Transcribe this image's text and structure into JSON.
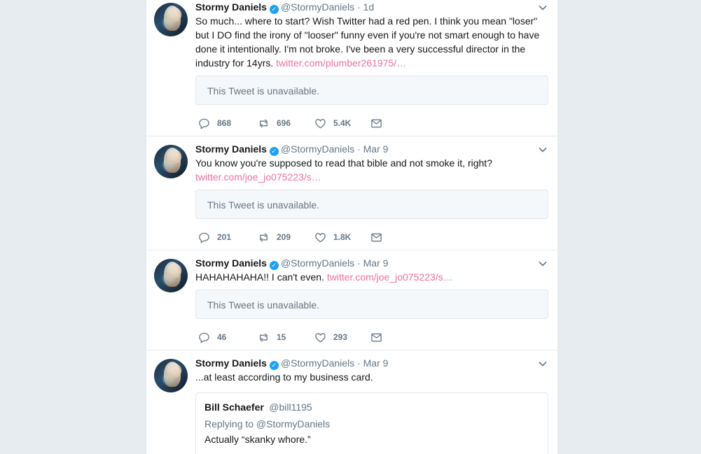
{
  "tweets": [
    {
      "name": "Stormy Daniels",
      "handle": "@StormyDaniels",
      "sep": "·",
      "time": "1d",
      "text": "So much... where to start? Wish Twitter had a red pen. I think you mean \"loser\" but I DO find the irony of \"looser\" funny even if you're not smart enough to have done it intentionally. I'm not broke. I've been a very successful director in the industry for 14yrs.",
      "link": "twitter.com/plumber261975/…",
      "unavailable": "This Tweet is unavailable.",
      "replies": "868",
      "retweets": "696",
      "likes": "5.4K"
    },
    {
      "name": "Stormy Daniels",
      "handle": "@StormyDaniels",
      "sep": "·",
      "time": "Mar 9",
      "text": "You know you're supposed to read that bible and not smoke it, right?",
      "link": "twitter.com/joe_jo075223/s…",
      "unavailable": "This Tweet is unavailable.",
      "replies": "201",
      "retweets": "209",
      "likes": "1.8K"
    },
    {
      "name": "Stormy Daniels",
      "handle": "@StormyDaniels",
      "sep": "·",
      "time": "Mar 9",
      "text": "HAHAHAHAHA!! I can't even.",
      "link": "twitter.com/joe_jo075223/s…",
      "unavailable": "This Tweet is unavailable.",
      "replies": "46",
      "retweets": "15",
      "likes": "293"
    },
    {
      "name": "Stormy Daniels",
      "handle": "@StormyDaniels",
      "sep": "·",
      "time": "Mar 9",
      "text": "...at least according to my business card.",
      "quoted": {
        "name": "Bill Schaefer",
        "handle": "@bill1195",
        "replying": "Replying to @StormyDaniels",
        "text": "Actually “skanky whore.”"
      }
    }
  ],
  "icons": {
    "verified": "verified-badge-icon",
    "caret": "chevron-down-icon",
    "reply": "reply-icon",
    "retweet": "retweet-icon",
    "like": "heart-icon",
    "dm": "envelope-icon"
  },
  "colors": {
    "link": "#f06fa0",
    "verified": "#1da1f2",
    "background": "#e6ecf0"
  }
}
